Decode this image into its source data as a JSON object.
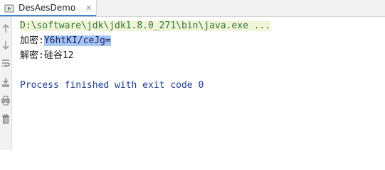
{
  "tab": {
    "title": "DesAesDemo",
    "close_glyph": "✕",
    "icon": "run-config-icon"
  },
  "gutter": {
    "icons": [
      "arrow-up-icon",
      "arrow-down-icon",
      "soft-wrap-icon",
      "scroll-to-end-icon",
      "print-icon",
      "trash-icon"
    ]
  },
  "console": {
    "command": "D:\\software\\jdk\\jdk1.8.0_271\\bin\\java.exe ...",
    "encrypt_label": "加密:",
    "encrypt_value": "Y6htKI/ceJg=",
    "decrypt_line": "解密:硅谷12",
    "exit_message": "Process finished with exit code 0"
  },
  "colors": {
    "command": "#2a7a2a",
    "selection": "#a6c8f0",
    "process": "#1e3c9c",
    "tab_underline": "#3d86d8"
  }
}
